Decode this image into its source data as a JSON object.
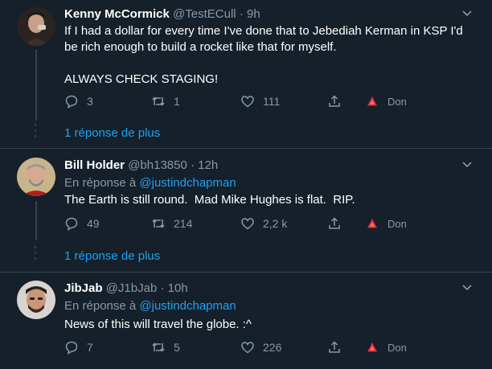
{
  "colors": {
    "background": "#15202b",
    "accent": "#1da1f2",
    "muted": "#8899a6",
    "separator": "#38444d",
    "don_icon": "#e0245e"
  },
  "tweets": [
    {
      "name": "Kenny McCormick",
      "handle": "@TestECull",
      "dot": "·",
      "time": "9h",
      "text": "If I had a dollar for every time I've done that to Jebediah Kerman in KSP I'd be rich enough to build a rocket like that for myself.\n\nALWAYS CHECK STAGING!",
      "replies": "3",
      "retweets": "1",
      "likes": "111",
      "don": "Don",
      "more": "1 réponse de plus"
    },
    {
      "name": "Bill Holder",
      "handle": "@bh13850",
      "dot": "·",
      "time": "12h",
      "reply_prefix": "En réponse à",
      "reply_mention": "@justindchapman",
      "text": "The Earth is still round.  Mad Mike Hughes is flat.  RIP.",
      "replies": "49",
      "retweets": "214",
      "likes": "2,2 k",
      "don": "Don",
      "more": "1 réponse de plus"
    },
    {
      "name": "JibJab",
      "handle": "@J1bJab",
      "dot": "·",
      "time": "10h",
      "reply_prefix": "En réponse à",
      "reply_mention": "@justindchapman",
      "text": "News of this will travel the globe. :^",
      "replies": "7",
      "retweets": "5",
      "likes": "226",
      "don": "Don"
    }
  ]
}
